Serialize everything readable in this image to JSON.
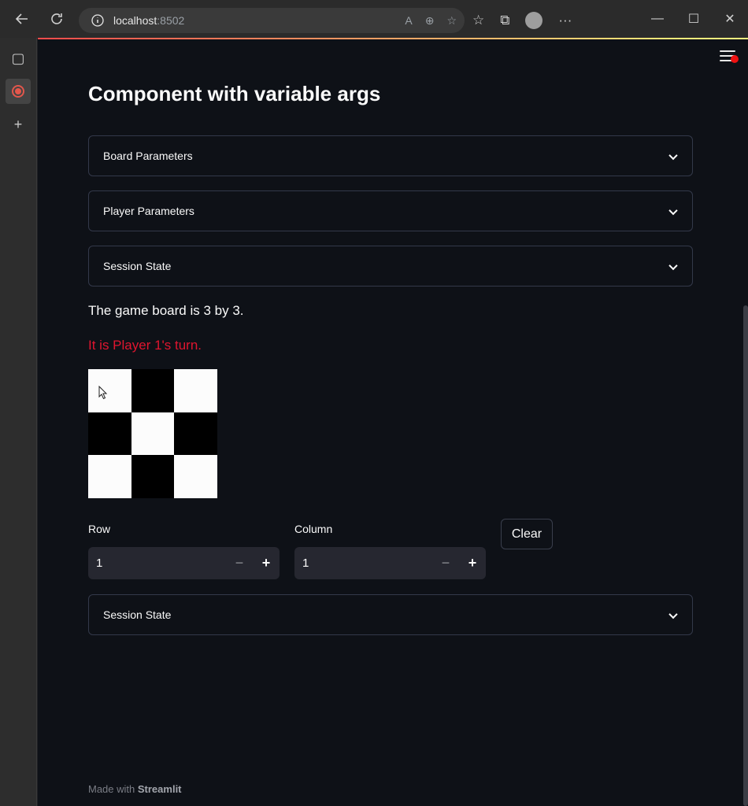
{
  "browser": {
    "url_host": "localhost",
    "url_port": ":8502",
    "back_icon": "arrow-left-icon",
    "refresh_icon": "refresh-icon"
  },
  "app": {
    "title": "Component with variable args",
    "expanders": [
      {
        "label": "Board Parameters"
      },
      {
        "label": "Player Parameters"
      },
      {
        "label": "Session State"
      }
    ],
    "board_info": "The game board is 3 by 3.",
    "turn_text": "It is Player 1's turn.",
    "turn_color": "#e0152f",
    "board": {
      "rows": 3,
      "cols": 3,
      "cells": [
        "white",
        "black",
        "white",
        "black",
        "white",
        "black",
        "white",
        "black",
        "white"
      ]
    },
    "row_field": {
      "label": "Row",
      "value": "1",
      "minus": "−",
      "plus": "+"
    },
    "column_field": {
      "label": "Column",
      "value": "1",
      "minus": "−",
      "plus": "+"
    },
    "clear_label": "Clear",
    "bottom_expander": {
      "label": "Session State"
    },
    "footer": {
      "prefix": "Made with",
      "brand": "Streamlit"
    }
  }
}
